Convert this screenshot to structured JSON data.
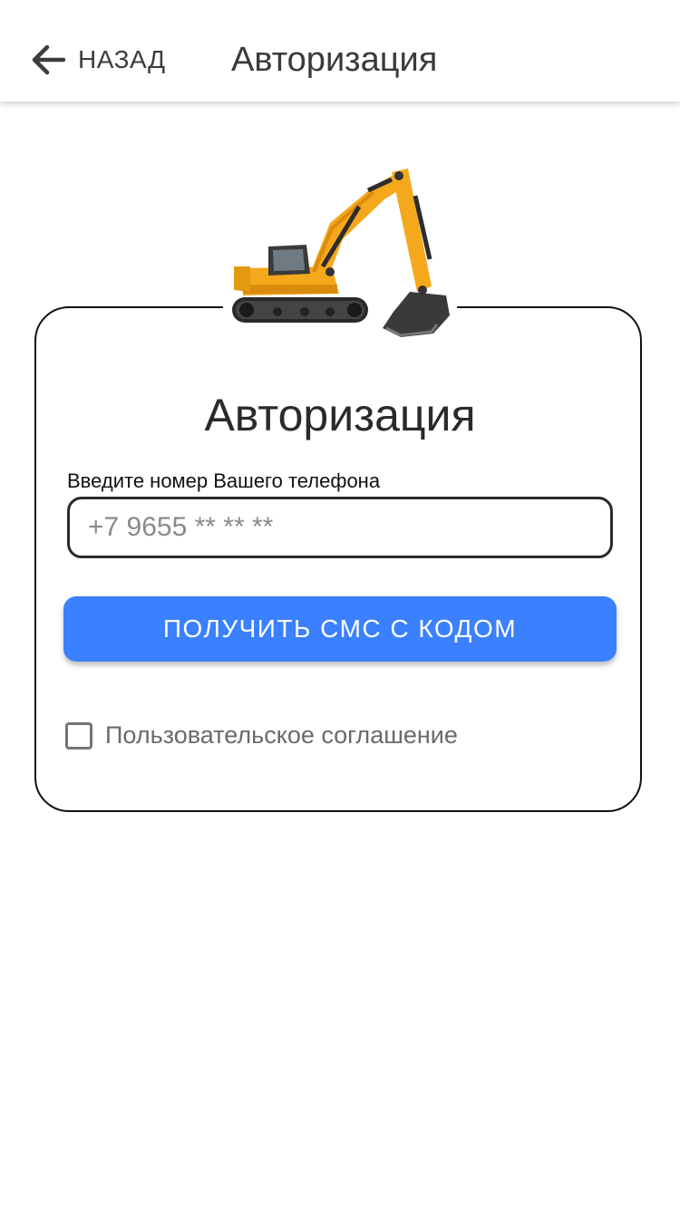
{
  "header": {
    "back_label": "НАЗАД",
    "title": "Авторизация"
  },
  "card": {
    "title": "Авторизация",
    "phone_label": "Введите номер Вашего телефона",
    "phone_placeholder": "+7 9655 ** ** **",
    "phone_value": "",
    "submit_label": "ПОЛУЧИТЬ СМС С КОДОМ",
    "agreement_label": "Пользовательское соглашение",
    "agreement_checked": false
  },
  "colors": {
    "accent": "#3a80ff",
    "excavator": "#f5a81c"
  },
  "icons": {
    "back": "arrow-left-icon",
    "hero": "excavator-illustration"
  }
}
